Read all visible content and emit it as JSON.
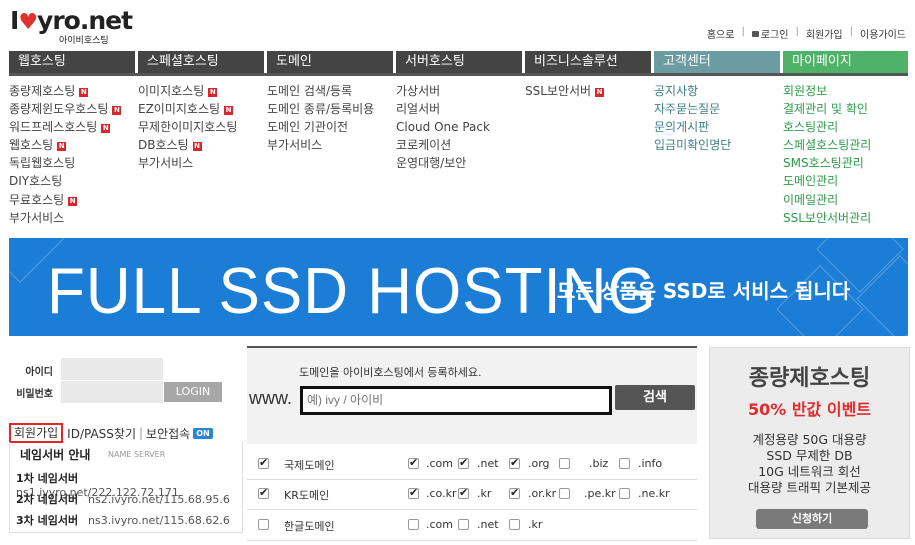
{
  "logo": {
    "text_before": "I",
    "heart": "♥",
    "text_after": "yro.net",
    "subtitle": "아이비호스팅"
  },
  "toplinks": {
    "home": "홈으로",
    "login": "로그인",
    "join": "회원가입",
    "guide": "이용가이드",
    "separator": "|"
  },
  "nav": [
    {
      "label": "웹호스팅"
    },
    {
      "label": "스페셜호스팅"
    },
    {
      "label": "도메인"
    },
    {
      "label": "서버호스팅"
    },
    {
      "label": "비즈니스솔루션"
    },
    {
      "label": "고객센터"
    },
    {
      "label": "마이페이지"
    }
  ],
  "new_badge": "N",
  "menus": {
    "webhosting": [
      {
        "label": "종량제호스팅",
        "new": true
      },
      {
        "label": "종량제윈도우호스팅",
        "new": true
      },
      {
        "label": "워드프레스호스팅",
        "new": true
      },
      {
        "label": "웹호스팅",
        "new": true
      },
      {
        "label": "독립웹호스팅",
        "new": false
      },
      {
        "label": "DIY호스팅",
        "new": false
      },
      {
        "label": "무료호스팅",
        "new": true
      },
      {
        "label": "부가서비스",
        "new": false
      }
    ],
    "special": [
      {
        "label": "이미지호스팅",
        "new": true
      },
      {
        "label": "EZ이미지호스팅",
        "new": true
      },
      {
        "label": "무제한이미지호스팅",
        "new": false
      },
      {
        "label": "DB호스팅",
        "new": true
      },
      {
        "label": "부가서비스",
        "new": false
      }
    ],
    "domain": [
      "도메인 검색/등록",
      "도메인 종류/등록비용",
      "도메인 기관이전",
      "부가서비스"
    ],
    "server": [
      "가상서버",
      "리얼서버",
      "Cloud One Pack",
      "코로케이션",
      "운영대행/보안"
    ],
    "business": [
      {
        "label": "SSL보안서버",
        "new": true
      }
    ],
    "support": [
      "공지사항",
      "자주묻는질문",
      "문의게시판",
      "입금미확인명단"
    ],
    "mypage": [
      "회원정보",
      "결제관리 및 확인",
      "호스팅관리",
      "스페셜호스팅관리",
      "SMS호스팅관리",
      "도메인관리",
      "이메일관리",
      "SSL보안서버관리"
    ]
  },
  "banner": {
    "title": "FULL SSD HOSTING",
    "subtitle": "모든 상품은 SSD로 서비스 됩니다"
  },
  "login": {
    "id_label": "아이디",
    "pw_label": "비밀번호",
    "button": "LOGIN",
    "register": "회원가입",
    "idpass": "ID/PASS찾기",
    "separator": "|",
    "secure": "보안접속",
    "secure_badge": "ON"
  },
  "nameserver": {
    "title": "네임서버 안내",
    "subtitle": "NAME SERVER",
    "rows": [
      {
        "label": "1차 네임서버",
        "value": "ns1.ivyro.net/222.122.72.171"
      },
      {
        "label": "2차 네임서버",
        "value": "ns2.ivyro.net/115.68.95.6"
      },
      {
        "label": "3차 네임서버",
        "value": "ns3.ivyro.net/115.68.62.6"
      }
    ]
  },
  "domain_search": {
    "description": "도메인을 아이비호스팅에서 등록하세요.",
    "prefix": "www.",
    "placeholder": "예) ivy / 아이비",
    "button": "검색",
    "rows": [
      {
        "label": "국제도메인",
        "checked": true,
        "tlds": [
          {
            "t": ".com",
            "c": true
          },
          {
            "t": ".net",
            "c": true
          },
          {
            "t": ".org",
            "c": true
          },
          {
            "t": ".biz",
            "c": false
          },
          {
            "t": ".info",
            "c": false
          }
        ]
      },
      {
        "label": "KR도메인",
        "checked": true,
        "tlds": [
          {
            "t": ".co.kr",
            "c": true
          },
          {
            "t": ".kr",
            "c": true
          },
          {
            "t": ".or.kr",
            "c": true
          },
          {
            "t": ".pe.kr",
            "c": false
          },
          {
            "t": ".ne.kr",
            "c": false
          }
        ]
      },
      {
        "label": "한글도메인",
        "checked": false,
        "tlds": [
          {
            "t": ".com",
            "c": false
          },
          {
            "t": ".net",
            "c": false
          },
          {
            "t": ".kr",
            "c": false
          }
        ]
      }
    ]
  },
  "ad": {
    "title": "종량제호스팅",
    "promo": "50% 반값 이벤트",
    "lines": [
      "계정용량 50G 대용량",
      "SSD 무제한 DB",
      "10G 네트워크 회선",
      "대용량 트래픽 기본제공"
    ],
    "button": "신청하기"
  },
  "colors": {
    "nav_dark": "#444444",
    "nav_teal": "#6a9ca1",
    "nav_green": "#4fb269",
    "banner": "#1b7dd6",
    "badge_red": "#d9262c",
    "promo_red": "#e32b2b"
  }
}
